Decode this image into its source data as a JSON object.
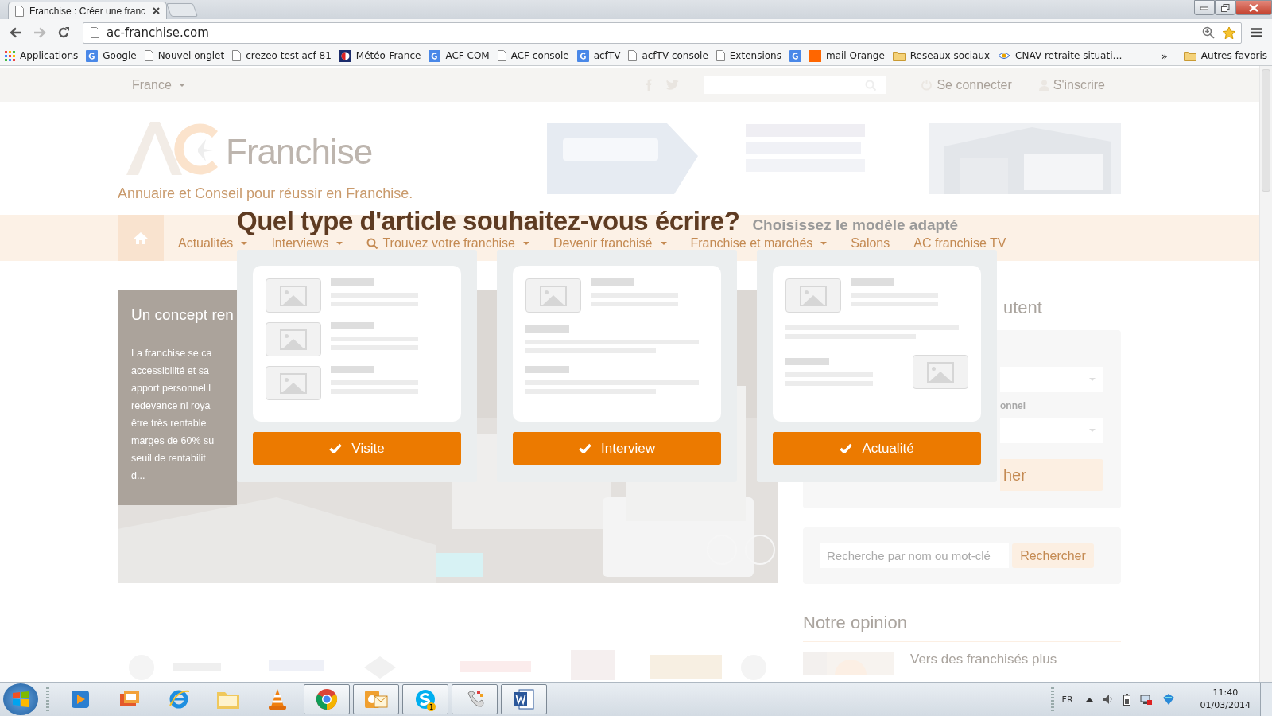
{
  "browser": {
    "tab_title": "Franchise : Créer une franc",
    "url": "ac-franchise.com",
    "bookmarks": [
      {
        "kind": "apps",
        "label": "Applications"
      },
      {
        "kind": "google",
        "label": "Google"
      },
      {
        "kind": "page",
        "label": "Nouvel onglet"
      },
      {
        "kind": "page",
        "label": "crezeo test acf 81"
      },
      {
        "kind": "meteo",
        "label": "Météo-France"
      },
      {
        "kind": "google",
        "label": "ACF COM"
      },
      {
        "kind": "page",
        "label": "ACF console"
      },
      {
        "kind": "google",
        "label": "acfTV"
      },
      {
        "kind": "page",
        "label": "acfTV console"
      },
      {
        "kind": "page",
        "label": "Extensions"
      },
      {
        "kind": "google"
      },
      {
        "kind": "orange",
        "label": "mail Orange"
      },
      {
        "kind": "folder",
        "label": "Reseaux sociaux"
      },
      {
        "kind": "cnav",
        "label": "CNAV retraite situati…"
      }
    ],
    "overflow": "»",
    "other_bookmarks": "Autres favoris"
  },
  "site": {
    "topbar": {
      "region": "France",
      "login": "Se connecter",
      "signup": "S'inscrire"
    },
    "header": {
      "logo": "Franchise",
      "tagline": "Annuaire et Conseil pour réussir en Franchise."
    },
    "nav": [
      {
        "label": "Actualités",
        "dropdown": true,
        "search_icon": false
      },
      {
        "label": "Interviews",
        "dropdown": true,
        "search_icon": false
      },
      {
        "label": "Trouvez votre franchise",
        "dropdown": true,
        "search_icon": true
      },
      {
        "label": "Devenir franchisé",
        "dropdown": true,
        "search_icon": false
      },
      {
        "label": "Franchise et marchés",
        "dropdown": true,
        "search_icon": false
      },
      {
        "label": "Salons",
        "dropdown": false,
        "search_icon": false
      },
      {
        "label": "AC franchise TV",
        "dropdown": false,
        "search_icon": false
      }
    ],
    "slider": {
      "title": "Un concept ren",
      "lines": [
        "La franchise se ca",
        "accessibilité et sa",
        "apport personnel l",
        "redevance ni roya",
        "être très rentable",
        "marges de 60% su",
        "seuil de rentabilit",
        "d..."
      ]
    },
    "sidebar": {
      "heading": "utent",
      "field_label": "onnel",
      "button": "her",
      "search_placeholder": "Recherche par nom ou mot-clé",
      "search_button": "Rechercher",
      "opinion_heading": "Notre opinion",
      "opinion_item": "Vers des franchisés plus"
    }
  },
  "modal": {
    "title": "Quel type d'article souhaitez-vous écrire?",
    "subtitle": "Choisissez le modèle adapté",
    "options": [
      {
        "label": "Visite",
        "kind": "list"
      },
      {
        "label": "Interview",
        "kind": "interview"
      },
      {
        "label": "Actualité",
        "kind": "news"
      }
    ]
  },
  "taskbar": {
    "apps": [
      {
        "kind": "media",
        "open": false
      },
      {
        "kind": "slides",
        "open": false
      },
      {
        "kind": "ie",
        "open": false
      },
      {
        "kind": "explorer",
        "open": false
      },
      {
        "kind": "vlc",
        "open": false
      },
      {
        "kind": "chrome",
        "open": true
      },
      {
        "kind": "outlook",
        "open": true
      },
      {
        "kind": "skype",
        "open": true,
        "badge": "1"
      },
      {
        "kind": "phone",
        "open": true
      },
      {
        "kind": "word",
        "open": true
      }
    ],
    "language": "FR",
    "time": "11:40",
    "date": "01/03/2014"
  }
}
